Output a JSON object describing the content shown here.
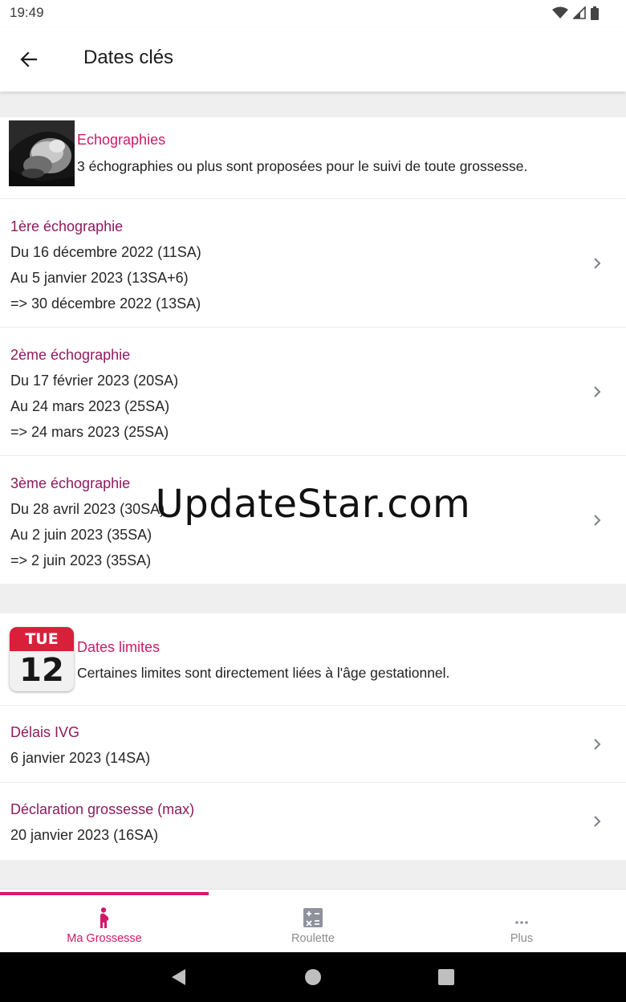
{
  "status_bar": {
    "time": "19:49"
  },
  "app_bar": {
    "title": "Dates clés"
  },
  "echographies": {
    "title": "Echographies",
    "description": "3 échographies ou plus sont proposées pour le suivi de toute grossesse.",
    "items": [
      {
        "title": "1ère échographie",
        "lines": [
          "Du 16 décembre 2022 (11SA)",
          "Au 5 janvier 2023 (13SA+6)",
          "=> 30 décembre 2022 (13SA)"
        ]
      },
      {
        "title": "2ème échographie",
        "lines": [
          "Du 17 février 2023 (20SA)",
          "Au 24 mars 2023 (25SA)",
          "=> 24 mars 2023 (25SA)"
        ]
      },
      {
        "title": "3ème échographie",
        "lines": [
          "Du 28 avril 2023 (30SA)",
          "Au 2 juin 2023 (35SA)",
          "=> 2 juin 2023 (35SA)"
        ]
      }
    ]
  },
  "dates_limites": {
    "calendar_day_name": "TUE",
    "calendar_day_number": "12",
    "title": "Dates limites",
    "description": "Certaines limites sont directement liées à l'âge gestationnel.",
    "items": [
      {
        "title": "Délais IVG",
        "lines": [
          "6 janvier 2023 (14SA)"
        ]
      },
      {
        "title": "Déclaration grossesse (max)",
        "lines": [
          "20 janvier 2023 (16SA)"
        ]
      }
    ]
  },
  "watermark": "UpdateStar.com",
  "bottom_nav": {
    "tabs": [
      {
        "label": "Ma Grossesse",
        "icon": "pregnant-woman-icon",
        "active": true
      },
      {
        "label": "Roulette",
        "icon": "calculator-icon",
        "active": false
      },
      {
        "label": "Plus",
        "icon": "more-dots-icon",
        "active": false
      }
    ]
  },
  "colors": {
    "accent": "#cf1a68",
    "item_title": "#8e1a5d",
    "background": "#efefef"
  }
}
